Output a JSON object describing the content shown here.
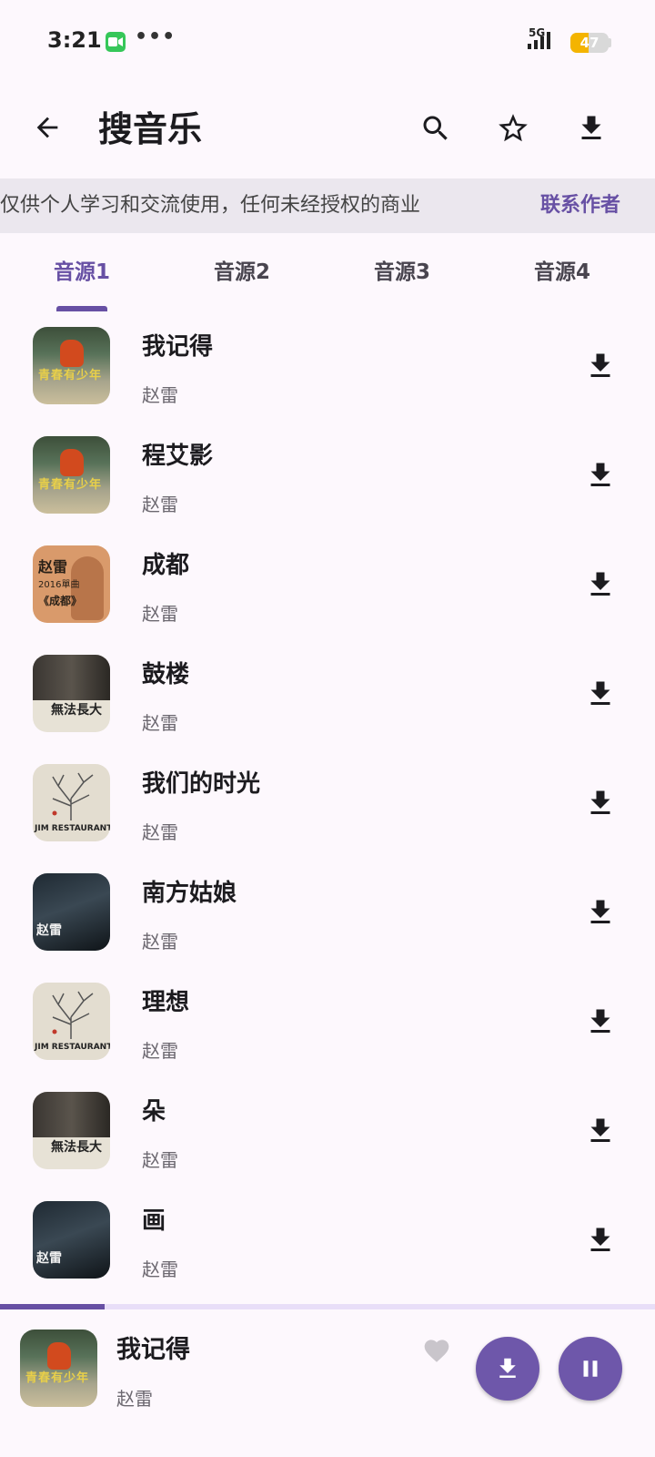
{
  "status_bar": {
    "time": "3:21",
    "dots": "•••",
    "network": "5G",
    "battery": "47",
    "battery_level": 0.47
  },
  "app_bar": {
    "title": "搜音乐"
  },
  "notice": {
    "text": "数据仅供个人学习和交流使用，任何未经授权的商业",
    "link": "联系作者"
  },
  "tabs": [
    {
      "label": "音源1",
      "active": true
    },
    {
      "label": "音源2",
      "active": false
    },
    {
      "label": "音源3",
      "active": false
    },
    {
      "label": "音源4",
      "active": false
    }
  ],
  "songs": [
    {
      "title": "我记得",
      "artist": "赵雷",
      "cover": "art-youth"
    },
    {
      "title": "程艾影",
      "artist": "赵雷",
      "cover": "art-youth"
    },
    {
      "title": "成都",
      "artist": "赵雷",
      "cover": "art-chengdu"
    },
    {
      "title": "鼓楼",
      "artist": "赵雷",
      "cover": "art-photo"
    },
    {
      "title": "我们的时光",
      "artist": "赵雷",
      "cover": "art-tree"
    },
    {
      "title": "南方姑娘",
      "artist": "赵雷",
      "cover": "art-dark"
    },
    {
      "title": "理想",
      "artist": "赵雷",
      "cover": "art-tree"
    },
    {
      "title": "朵",
      "artist": "赵雷",
      "cover": "art-photo"
    },
    {
      "title": "画",
      "artist": "赵雷",
      "cover": "art-dark"
    }
  ],
  "cover_text": {
    "youth": "青春有少年",
    "chengdu_1": "赵雷",
    "chengdu_2": "2016單曲",
    "chengdu_3": "《成都》",
    "photo": "無法長大",
    "tree": "JIM RESTAURANT",
    "dark": "赵雷"
  },
  "player": {
    "title": "我记得",
    "artist": "赵雷",
    "progress": 0.16
  },
  "colors": {
    "accent": "#6750a4",
    "background": "#fdf8fd"
  }
}
